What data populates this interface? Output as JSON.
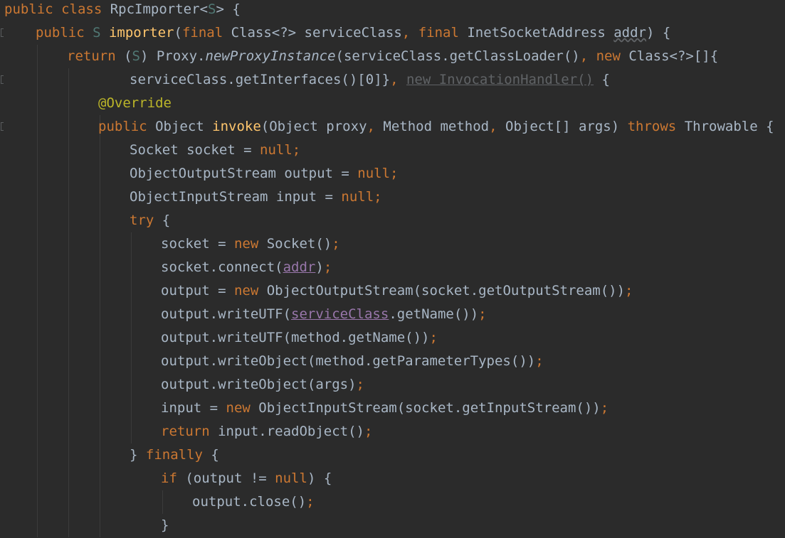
{
  "editor": {
    "language": "Java",
    "lines": [
      {
        "indent": 0,
        "tokens": [
          {
            "t": "public class ",
            "c": "kw"
          },
          {
            "t": "RpcImporter",
            "c": "ty"
          },
          {
            "t": "<",
            "c": "ty"
          },
          {
            "t": "S",
            "c": "tp"
          },
          {
            "t": "> {",
            "c": "ty"
          }
        ]
      },
      {
        "indent": 1,
        "tokens": [
          {
            "t": "public ",
            "c": "kw"
          },
          {
            "t": "S ",
            "c": "tp"
          },
          {
            "t": "importer",
            "c": "fn"
          },
          {
            "t": "(",
            "c": "ty"
          },
          {
            "t": "final ",
            "c": "kw"
          },
          {
            "t": "Class<?> serviceClass",
            "c": "ty"
          },
          {
            "t": ", ",
            "c": "pn"
          },
          {
            "t": "final ",
            "c": "kw"
          },
          {
            "t": "InetSocketAddress ",
            "c": "ty"
          },
          {
            "t": "addr",
            "c": "ty squiggle"
          },
          {
            "t": ") {",
            "c": "ty"
          }
        ]
      },
      {
        "indent": 2,
        "tokens": [
          {
            "t": "return ",
            "c": "kw"
          },
          {
            "t": "(",
            "c": "ty"
          },
          {
            "t": "S",
            "c": "tp"
          },
          {
            "t": ") Proxy.",
            "c": "ty"
          },
          {
            "t": "newProxyInstance",
            "c": "ty it"
          },
          {
            "t": "(serviceClass.getClassLoader()",
            "c": "ty"
          },
          {
            "t": ", ",
            "c": "pn"
          },
          {
            "t": "new ",
            "c": "kw"
          },
          {
            "t": "Class<?>[]{",
            "c": "ty"
          }
        ]
      },
      {
        "indent": 4,
        "tokens": [
          {
            "t": "serviceClass.getInterfaces()[",
            "c": "ty"
          },
          {
            "t": "0",
            "c": "ty"
          },
          {
            "t": "]}",
            "c": "ty"
          },
          {
            "t": ", ",
            "c": "pn"
          },
          {
            "t": "new InvocationHandler()",
            "c": "grey uline"
          },
          {
            "t": " {",
            "c": "ty"
          }
        ]
      },
      {
        "indent": 3,
        "tokens": [
          {
            "t": "@Override",
            "c": "ann"
          }
        ]
      },
      {
        "indent": 3,
        "tokens": [
          {
            "t": "public ",
            "c": "kw"
          },
          {
            "t": "Object ",
            "c": "ty"
          },
          {
            "t": "invoke",
            "c": "fn"
          },
          {
            "t": "(Object proxy",
            "c": "ty"
          },
          {
            "t": ", ",
            "c": "pn"
          },
          {
            "t": "Method method",
            "c": "ty"
          },
          {
            "t": ", ",
            "c": "pn"
          },
          {
            "t": "Object[] args) ",
            "c": "ty"
          },
          {
            "t": "throws ",
            "c": "kw"
          },
          {
            "t": "Throwable {",
            "c": "ty"
          }
        ]
      },
      {
        "indent": 4,
        "tokens": [
          {
            "t": "Socket socket = ",
            "c": "ty"
          },
          {
            "t": "null;",
            "c": "kw"
          }
        ]
      },
      {
        "indent": 4,
        "tokens": [
          {
            "t": "ObjectOutputStream output = ",
            "c": "ty"
          },
          {
            "t": "null;",
            "c": "kw"
          }
        ]
      },
      {
        "indent": 4,
        "tokens": [
          {
            "t": "ObjectInputStream input = ",
            "c": "ty"
          },
          {
            "t": "null;",
            "c": "kw"
          }
        ]
      },
      {
        "indent": 4,
        "tokens": [
          {
            "t": "try ",
            "c": "kw"
          },
          {
            "t": "{",
            "c": "ty"
          }
        ]
      },
      {
        "indent": 5,
        "tokens": [
          {
            "t": "socket = ",
            "c": "ty"
          },
          {
            "t": "new ",
            "c": "kw"
          },
          {
            "t": "Socket()",
            "c": "ty"
          },
          {
            "t": ";",
            "c": "kw"
          }
        ]
      },
      {
        "indent": 5,
        "tokens": [
          {
            "t": "socket.connect(",
            "c": "ty"
          },
          {
            "t": "addr",
            "c": "field"
          },
          {
            "t": ")",
            "c": "ty"
          },
          {
            "t": ";",
            "c": "kw"
          }
        ]
      },
      {
        "indent": 5,
        "tokens": [
          {
            "t": "output = ",
            "c": "ty"
          },
          {
            "t": "new ",
            "c": "kw"
          },
          {
            "t": "ObjectOutputStream(socket.getOutputStream())",
            "c": "ty"
          },
          {
            "t": ";",
            "c": "kw"
          }
        ]
      },
      {
        "indent": 5,
        "tokens": [
          {
            "t": "output.writeUTF(",
            "c": "ty"
          },
          {
            "t": "serviceClass",
            "c": "field"
          },
          {
            "t": ".getName())",
            "c": "ty"
          },
          {
            "t": ";",
            "c": "kw"
          }
        ]
      },
      {
        "indent": 5,
        "tokens": [
          {
            "t": "output.writeUTF(method.getName())",
            "c": "ty"
          },
          {
            "t": ";",
            "c": "kw"
          }
        ]
      },
      {
        "indent": 5,
        "tokens": [
          {
            "t": "output.writeObject(method.getParameterTypes())",
            "c": "ty"
          },
          {
            "t": ";",
            "c": "kw"
          }
        ]
      },
      {
        "indent": 5,
        "tokens": [
          {
            "t": "output.writeObject(args)",
            "c": "ty"
          },
          {
            "t": ";",
            "c": "kw"
          }
        ]
      },
      {
        "indent": 5,
        "tokens": [
          {
            "t": "input = ",
            "c": "ty"
          },
          {
            "t": "new ",
            "c": "kw"
          },
          {
            "t": "ObjectInputStream(socket.getInputStream())",
            "c": "ty"
          },
          {
            "t": ";",
            "c": "kw"
          }
        ]
      },
      {
        "indent": 5,
        "tokens": [
          {
            "t": "return ",
            "c": "kw"
          },
          {
            "t": "input.readObject()",
            "c": "ty"
          },
          {
            "t": ";",
            "c": "kw"
          }
        ]
      },
      {
        "indent": 4,
        "tokens": [
          {
            "t": "} ",
            "c": "ty"
          },
          {
            "t": "finally ",
            "c": "kw"
          },
          {
            "t": "{",
            "c": "ty"
          }
        ]
      },
      {
        "indent": 5,
        "tokens": [
          {
            "t": "if ",
            "c": "kw"
          },
          {
            "t": "(output != ",
            "c": "ty"
          },
          {
            "t": "null",
            "c": "kw"
          },
          {
            "t": ") {",
            "c": "ty"
          }
        ]
      },
      {
        "indent": 6,
        "tokens": [
          {
            "t": "output.close()",
            "c": "ty"
          },
          {
            "t": ";",
            "c": "kw"
          }
        ]
      },
      {
        "indent": 5,
        "tokens": [
          {
            "t": "}",
            "c": "ty"
          }
        ]
      }
    ]
  },
  "colors": {
    "background": "#2b2b2b",
    "keyword": "#cc7832",
    "function": "#ffc66d",
    "annotation": "#bbb529",
    "field": "#9876aa",
    "text": "#a9b7c6"
  }
}
